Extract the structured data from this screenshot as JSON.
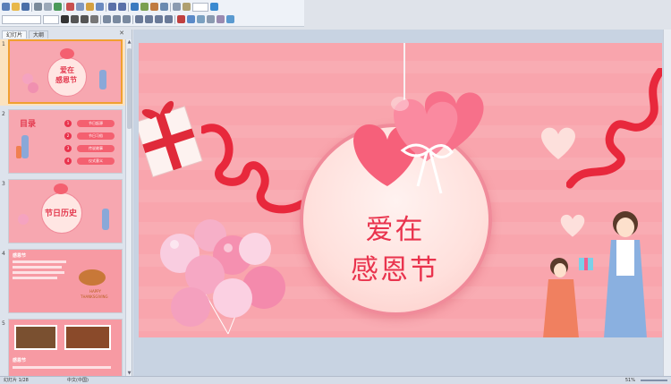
{
  "panel": {
    "tab_slides": "幻灯片",
    "tab_outline": "大纲",
    "close_glyph": "✕"
  },
  "thumbnails": [
    {
      "num": "1",
      "title_line1": "爱在",
      "title_line2": "感恩节"
    },
    {
      "num": "2",
      "title": "目录",
      "items": [
        "节日起源",
        "节日习俗",
        "传说故事",
        "仪式意义"
      ],
      "item_nums": [
        "1",
        "2",
        "3",
        "4"
      ]
    },
    {
      "num": "3",
      "title": "节日历史"
    },
    {
      "num": "4",
      "title": "感恩节",
      "caption_line1": "HAPPY",
      "caption_line2": "THANKSGIVING"
    },
    {
      "num": "5",
      "title": "感恩节"
    }
  ],
  "slide": {
    "title_line1": "爱在",
    "title_line2": "感恩节"
  },
  "status": {
    "slide_info": "幻灯片 1/28",
    "language": "中文(中国)",
    "view_zoom": "51%"
  },
  "colors": {
    "slide_bg": "#f9a5ad",
    "title": "#e9334d",
    "accent": "#f0a030"
  }
}
